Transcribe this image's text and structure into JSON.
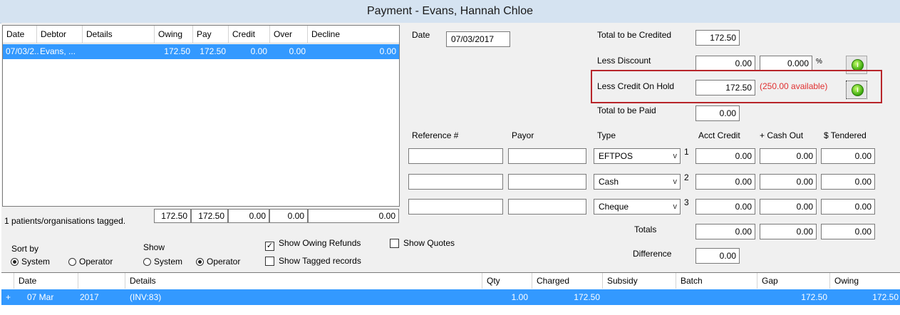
{
  "window": {
    "title": "Payment - Evans, Hannah Chloe"
  },
  "debtor_grid": {
    "columns": [
      "Date",
      "Debtor",
      "Details",
      "Owing",
      "Pay",
      "Credit",
      "Over",
      "Decline"
    ],
    "rows": [
      {
        "date": "07/03/2...",
        "debtor": "Evans, ...",
        "details": "",
        "owing": "172.50",
        "pay": "172.50",
        "credit": "0.00",
        "over": "0.00",
        "decline": "0.00"
      }
    ]
  },
  "tagged": {
    "text": "1 patients/organisations tagged.",
    "owing_total": "172.50",
    "pay_total": "172.50",
    "credit_total": "0.00",
    "over_total": "0.00",
    "decline_total": "0.00"
  },
  "sort_by": {
    "label": "Sort by",
    "options": [
      "System",
      "Operator"
    ],
    "selected": "System"
  },
  "show": {
    "label": "Show",
    "options": [
      "System",
      "Operator"
    ],
    "selected": "Operator"
  },
  "checkboxes": {
    "show_owing_refunds": {
      "label": "Show Owing Refunds",
      "checked": true
    },
    "show_tagged_records": {
      "label": "Show Tagged records",
      "checked": false
    },
    "show_quotes": {
      "label": "Show Quotes",
      "checked": false
    }
  },
  "date": {
    "label": "Date",
    "value": "07/03/2017"
  },
  "totals_block": {
    "total_to_be_credited": {
      "label": "Total to be Credited",
      "value": "172.50"
    },
    "less_discount": {
      "label": "Less Discount",
      "value": "0.00",
      "percent": "0.000",
      "percent_sign": "%"
    },
    "less_credit_on_hold": {
      "label": "Less Credit On Hold",
      "value": "172.50",
      "available": "(250.00 available)"
    },
    "total_to_be_paid": {
      "label": "Total to be Paid",
      "value": "0.00"
    }
  },
  "payment_grid": {
    "headers": {
      "reference": "Reference #",
      "payor": "Payor",
      "type": "Type",
      "acct_credit": "Acct Credit",
      "cash_out": "+ Cash Out",
      "tendered": "$ Tendered"
    },
    "rows": [
      {
        "num": "1",
        "reference": "",
        "payor": "",
        "type": "EFTPOS",
        "acct_credit": "0.00",
        "cash_out": "0.00",
        "tendered": "0.00"
      },
      {
        "num": "2",
        "reference": "",
        "payor": "",
        "type": "Cash",
        "acct_credit": "0.00",
        "cash_out": "0.00",
        "tendered": "0.00"
      },
      {
        "num": "3",
        "reference": "",
        "payor": "",
        "type": "Cheque",
        "acct_credit": "0.00",
        "cash_out": "0.00",
        "tendered": "0.00"
      }
    ],
    "totals": {
      "label": "Totals",
      "acct_credit": "0.00",
      "cash_out": "0.00",
      "tendered": "0.00"
    },
    "difference": {
      "label": "Difference",
      "value": "0.00"
    }
  },
  "detail_grid": {
    "columns": [
      "Date",
      "Details",
      "Qty",
      "Charged",
      "Subsidy",
      "Batch",
      "Gap",
      "Owing"
    ],
    "rows": [
      {
        "expander": "+",
        "date": "07 Mar",
        "year": "2017",
        "details": "(INV:83)",
        "qty": "1.00",
        "charged": "172.50",
        "subsidy": "",
        "batch": "",
        "gap": "172.50",
        "owing": "172.50"
      }
    ]
  },
  "colors": {
    "selection": "#3399ff",
    "highlight_border": "#b8252a",
    "available_text": "#e03030",
    "title_bg": "#d5e3f1"
  },
  "icons": {
    "info_button": "info-icon",
    "combo_arrow": "chevron-down-icon"
  }
}
